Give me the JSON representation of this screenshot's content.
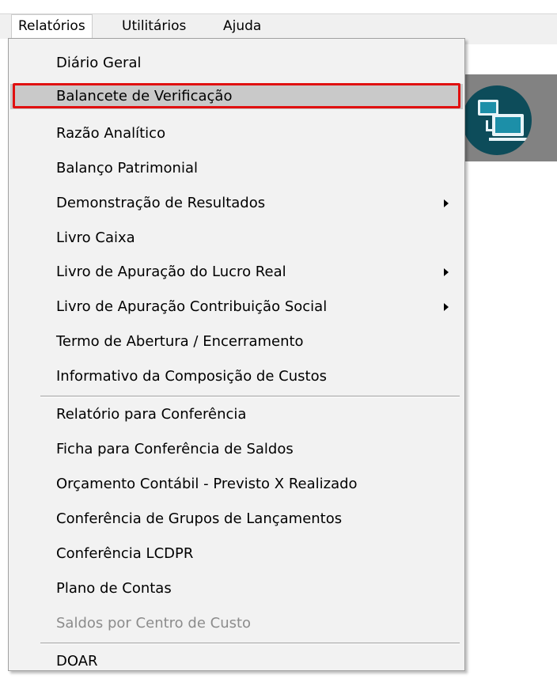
{
  "menubar": {
    "items": [
      {
        "label": "Relatórios"
      },
      {
        "label": "Utilitários"
      },
      {
        "label": "Ajuda"
      }
    ]
  },
  "dropdown": {
    "items": [
      {
        "label": "Diário Geral"
      },
      {
        "label": "Balancete de Verificação"
      },
      {
        "label": "Razão Analítico"
      },
      {
        "label": "Balanço Patrimonial"
      },
      {
        "label": "Demonstração de Resultados"
      },
      {
        "label": "Livro Caixa"
      },
      {
        "label": "Livro de Apuração do Lucro Real"
      },
      {
        "label": "Livro de Apuração Contribuição Social"
      },
      {
        "label": "Termo de Abertura / Encerramento"
      },
      {
        "label": "Informativo da Composição de Custos"
      },
      {
        "label": "Relatório para Conferência"
      },
      {
        "label": "Ficha para Conferência de Saldos"
      },
      {
        "label": "Orçamento Contábil - Previsto X Realizado"
      },
      {
        "label": "Conferência de Grupos de Lançamentos"
      },
      {
        "label": "Conferência LCDPR"
      },
      {
        "label": "Plano de Contas"
      },
      {
        "label": "Saldos por Centro de Custo"
      },
      {
        "label": "DOAR"
      }
    ]
  },
  "colors": {
    "highlight_border": "#e01010",
    "hover_background": "#c9c9c9",
    "menu_background": "#f2f2f2",
    "disabled_text": "#8c8c8c"
  },
  "icons": {
    "app_icon": "monitor-network-icon",
    "submenu_arrow": "chevron-right-icon"
  }
}
